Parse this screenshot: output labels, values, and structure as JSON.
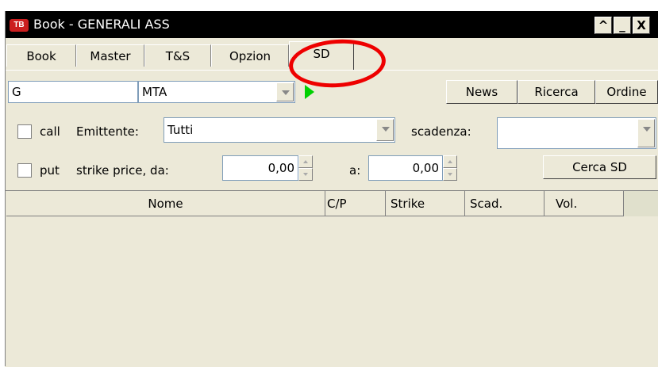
{
  "window": {
    "title": "Book - GENERALI ASS",
    "logo_text": "TB",
    "controls": {
      "restore": "^",
      "minimize": "_",
      "close": "X"
    }
  },
  "tabs": [
    {
      "label": "Book",
      "active": false
    },
    {
      "label": "Master",
      "active": false
    },
    {
      "label": "T&S",
      "active": false
    },
    {
      "label": "Opzion",
      "active": false
    },
    {
      "label": "SD",
      "active": true
    }
  ],
  "toolbar": {
    "symbol_value": "G",
    "market_value": "MTA",
    "news_label": "News",
    "ricerca_label": "Ricerca",
    "ordine_label": "Ordine"
  },
  "filters": {
    "call_label": "call",
    "emittente_label": "Emittente:",
    "emittente_value": "Tutti",
    "scadenza_label": "scadenza:",
    "scadenza_value": "",
    "put_label": "put",
    "strike_from_label": "strike price, da:",
    "strike_from_value": "0,00",
    "strike_to_label": "a:",
    "strike_to_value": "0,00",
    "search_button_label": "Cerca SD"
  },
  "table": {
    "columns": [
      "Nome",
      "C/P",
      "Strike",
      "Scad.",
      "Vol."
    ]
  },
  "colors": {
    "titlebar": "#000000",
    "window_bg": "#ece9d8",
    "annotation": "#ee0000",
    "play_indicator": "#00d000"
  }
}
